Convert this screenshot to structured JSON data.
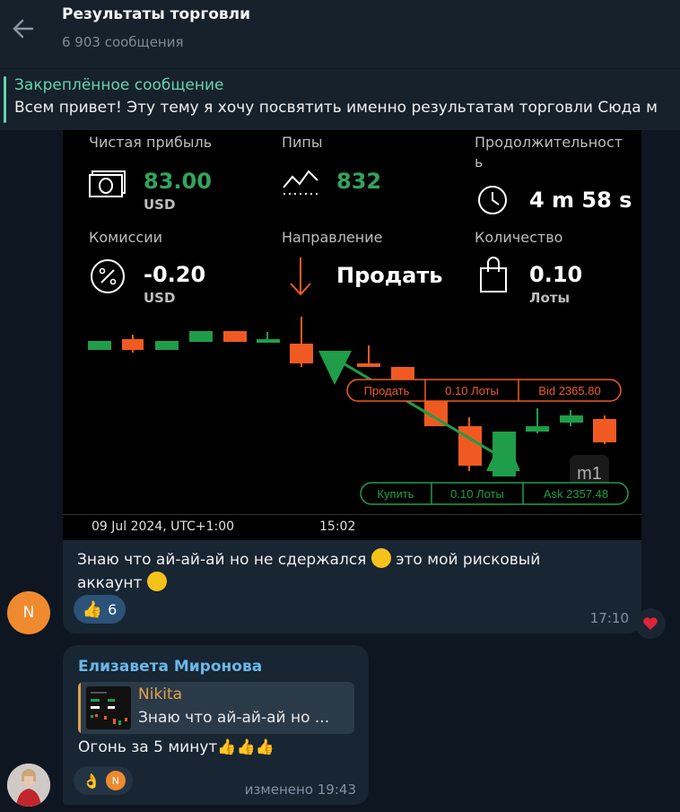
{
  "header": {
    "title": "Результаты торговли",
    "subtitle": "6 903 сообщения"
  },
  "pinned": {
    "title": "Закреплённое сообщение",
    "text": "Всем привет!   Эту тему я хочу посвятить именно результатам торговли  Сюда м"
  },
  "screenshot": {
    "net_profit_label": "Чистая прибыль",
    "net_profit_value": "83.00",
    "net_profit_unit": "USD",
    "pips_label": "Пипы",
    "pips_value": "832",
    "duration_label_1": "Продолжительност",
    "duration_label_2": "ь",
    "duration_value": "4 m 58 s",
    "commission_label": "Комиссии",
    "commission_value": "-0.20",
    "commission_unit": "USD",
    "direction_label": "Направление",
    "direction_value": "Продать",
    "quantity_label": "Количество",
    "quantity_value": "0.10",
    "quantity_unit": "Лоты",
    "sell_box": [
      "Продать",
      "0.10 Лоты",
      "Bid 2365.80"
    ],
    "buy_box": [
      "Купить",
      "0.10 Лоты",
      "Ask 2357.48"
    ],
    "timeframe": "m1",
    "x_label_date": "09 Jul 2024, UTC+1:00",
    "x_label_time": "15:02",
    "colors": {
      "up": "#1f9d48",
      "down": "#f05a22"
    }
  },
  "message1": {
    "text": "Знаю что ай-ай-ай но не сдержался 😅 это мой рисковый аккаунт 😁",
    "line1": "Знаю что ай-ай-ай но не сдержался",
    "line1b": "это мой рисковый",
    "line2": "аккаунт",
    "reaction_emoji": "👍",
    "reaction_count": "6",
    "time": "17:10",
    "avatar_letter": "N"
  },
  "message2": {
    "sender": "Елизавета Миронова",
    "reply_name": "Nikita",
    "reply_text": "Знаю что ай-ай-ай но ...",
    "text": "Огонь за 5 минут👍👍👍",
    "reaction_emoji": "👌",
    "reaction_avatar": "N",
    "time": "изменено 19:43"
  }
}
